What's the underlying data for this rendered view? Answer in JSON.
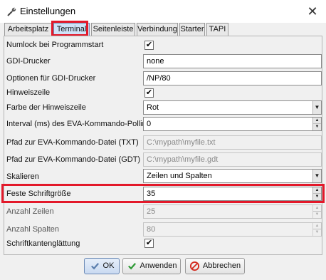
{
  "window": {
    "title": "Einstellungen",
    "close_glyph": "✕"
  },
  "icons": {
    "title": "wrench-icon",
    "ok": "check-icon",
    "apply": "check-icon",
    "cancel": "prohibited-icon"
  },
  "colors": {
    "highlight": "#e3192a",
    "active_tab": "#cfe3f8",
    "apply_check": "#2e9a35",
    "cancel_icon": "#d42a1e"
  },
  "tabs": [
    {
      "label": "Arbeitsplatz"
    },
    {
      "label": "Terminal",
      "active": true
    },
    {
      "label": "Seitenleiste"
    },
    {
      "label": "Verbindung"
    },
    {
      "label": "Starter"
    },
    {
      "label": "TAPI"
    }
  ],
  "settings": {
    "numlock": {
      "label": "Numlock bei Programmstart",
      "checked": true,
      "mark": "✔"
    },
    "gdi_printer": {
      "label": "GDI-Drucker",
      "value": "none"
    },
    "gdi_options": {
      "label": "Optionen für GDI-Drucker",
      "value": "/NP/80"
    },
    "hint_line": {
      "label": "Hinweiszeile",
      "checked": true,
      "mark": "✔"
    },
    "hint_color": {
      "label": "Farbe der Hinweiszeile",
      "value": "Rot",
      "arrow": "▼"
    },
    "eva_interval": {
      "label": "Interval (ms) des EVA-Kommando-Pollings",
      "value": "0",
      "up": "▲",
      "down": "▼"
    },
    "eva_txt": {
      "label": "Pfad zur EVA-Kommando-Datei (TXT)",
      "value": "C:\\mypath\\myfile.txt"
    },
    "eva_gdt": {
      "label": "Pfad zur EVA-Kommando-Datei (GDT)",
      "value": "C:\\mypath\\myfile.gdt"
    },
    "scale": {
      "label": "Skalieren",
      "value": "Zeilen und Spalten",
      "arrow": "▼"
    },
    "font_size": {
      "label": "Feste Schriftgröße",
      "value": "35",
      "up": "▲",
      "down": "▼"
    },
    "rows": {
      "label": "Anzahl Zeilen",
      "value": "25",
      "up": "▲",
      "down": "▼"
    },
    "cols": {
      "label": "Anzahl Spalten",
      "value": "80",
      "up": "▲",
      "down": "▼"
    },
    "antialias": {
      "label": "Schriftkantenglättung",
      "checked": true,
      "mark": "✔"
    }
  },
  "buttons": {
    "ok": "OK",
    "apply": "Anwenden",
    "cancel": "Abbrechen"
  }
}
